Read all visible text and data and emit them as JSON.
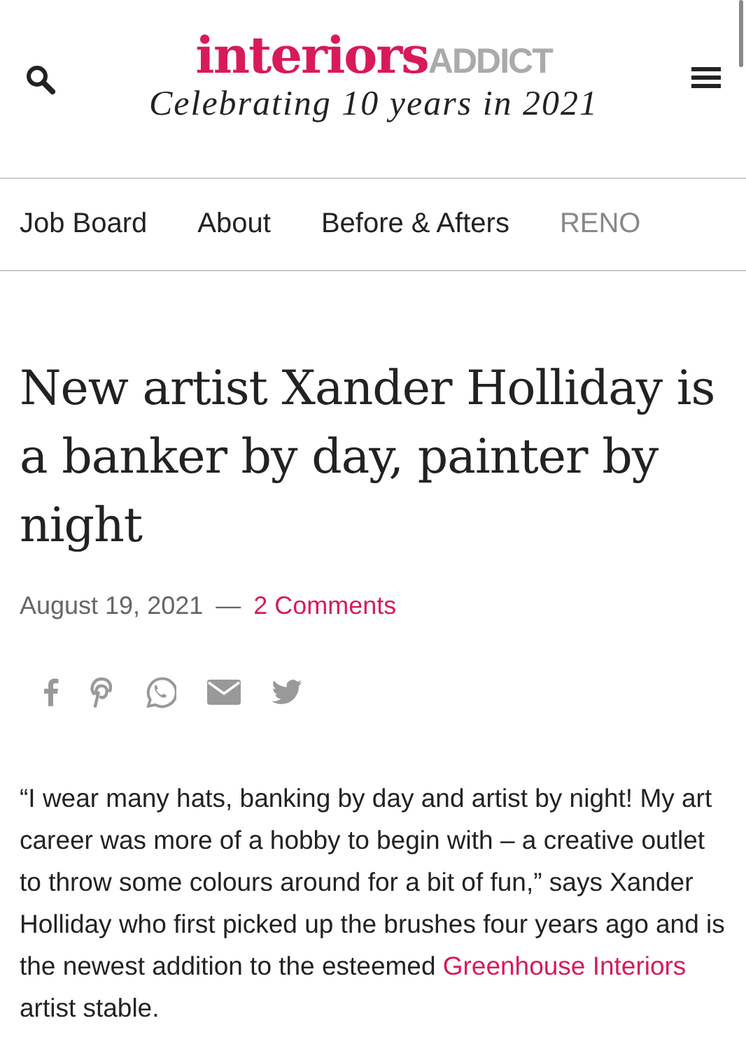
{
  "header": {
    "logo_main": "interiors",
    "logo_secondary": "ADDICT",
    "tagline": "Celebrating 10 years in 2021"
  },
  "nav": [
    {
      "label": "Job Board",
      "faded": false
    },
    {
      "label": "About",
      "faded": false
    },
    {
      "label": "Before & Afters",
      "faded": false
    },
    {
      "label": "RENO",
      "faded": true
    }
  ],
  "article": {
    "title": "New artist Xander Holliday is a banker by day, painter by night",
    "date": "August 19, 2021",
    "separator": "—",
    "comments_link": "2 Comments",
    "share": [
      {
        "kind": "facebook"
      },
      {
        "kind": "pinterest"
      },
      {
        "kind": "whatsapp"
      },
      {
        "kind": "email"
      },
      {
        "kind": "twitter"
      }
    ],
    "paragraph": {
      "before": "“I wear many hats, banking by day and artist by night! My art career was more of a hobby to begin with – a creative outlet to throw some colours around for a bit of fun,” says Xander Holliday who first picked up the brushes four years ago and is the newest addition to the esteemed ",
      "link": "Greenhouse Interiors",
      "after": " artist stable."
    }
  }
}
